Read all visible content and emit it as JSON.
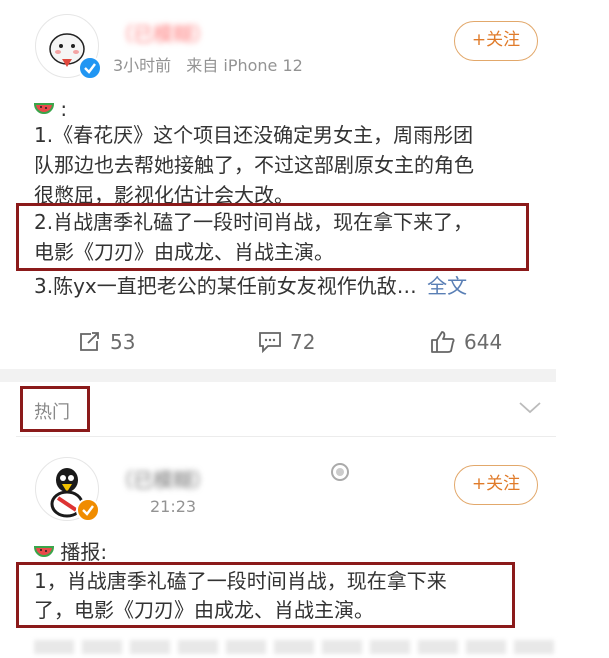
{
  "post1": {
    "author_name": "（已模糊）",
    "time": "3小时前",
    "source": "来自 iPhone 12",
    "follow_label": "+关注",
    "intro": ":",
    "lines": [
      "1.《春花厌》这个项目还没确定男女主，周雨彤团",
      "队那边也去帮她接触了，不过这部剧原女主的角色",
      "很憋屈，影视化估计会大改。",
      "2.肖战唐季礼磕了一段时间肖战，现在拿下来了，",
      "电影《刀刃》由成龙、肖战主演。",
      "3.陈yx一直把老公的某任前女友视作仇敌…"
    ],
    "full_text_link": "全文",
    "repost_count": "53",
    "comment_count": "72",
    "like_count": "644"
  },
  "section": {
    "hot_label": "热门"
  },
  "post2": {
    "author_name": "（已模糊）",
    "time": "21:23",
    "follow_label": "+关注",
    "intro": "播报:",
    "lines": [
      "1，肖战唐季礼磕了一段时间肖战，现在拿下来",
      "了，电影《刀刃》由成龙、肖战主演。"
    ]
  },
  "colors": {
    "follow": "#e07b2a",
    "highlight_box": "#8b1a1a",
    "link": "#5a7fb5",
    "verified": "#2196f3",
    "orange_badge": "#f08c00"
  },
  "icons": [
    "watermelon-icon",
    "repost-icon",
    "comment-icon",
    "like-icon",
    "chevron-down-icon",
    "verified-icon"
  ]
}
